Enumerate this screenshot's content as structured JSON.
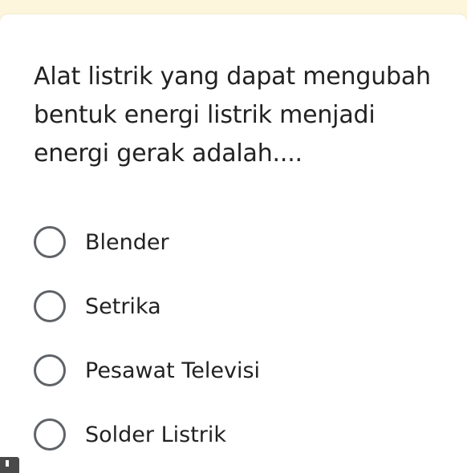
{
  "question": {
    "text": "Alat listrik yang dapat mengubah bentuk energi listrik menjadi energi gerak adalah...."
  },
  "options": [
    {
      "label": "Blender",
      "selected": false
    },
    {
      "label": "Setrika",
      "selected": false
    },
    {
      "label": "Pesawat Televisi",
      "selected": false
    },
    {
      "label": "Solder Listrik",
      "selected": false
    }
  ],
  "colors": {
    "background_strip": "#fdf6dc",
    "card": "#ffffff",
    "text": "#222222",
    "radio_border": "#5f6368",
    "corner_badge": "#4a4a4a"
  }
}
